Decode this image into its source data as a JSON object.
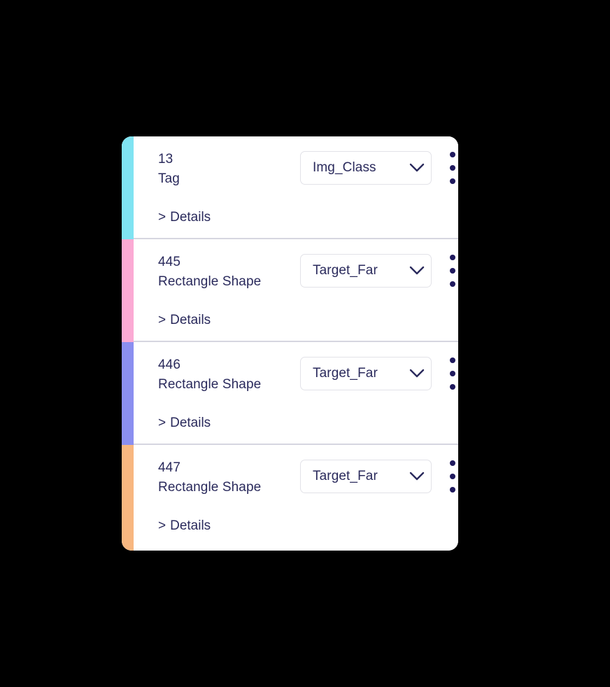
{
  "panel": {
    "name": "annotation-object-list",
    "background": "#000000",
    "card_background": "#ffffff",
    "divider_color": "#d6d6e0",
    "text_color": "#2a2a5c",
    "dot_color": "#201a5e",
    "select_border_color": "#e2e2e8"
  },
  "rows": [
    {
      "id": "13",
      "type": "Tag",
      "class_value": "Img_Class",
      "details_label": "Details",
      "details_chevron": ">",
      "strip_color": "#7fe3f2",
      "caret_icon": "chevron-down-icon",
      "menu_icon": "kebab-menu-icon"
    },
    {
      "id": "445",
      "type": "Rectangle Shape",
      "class_value": "Target_Far",
      "details_label": "Details",
      "details_chevron": ">",
      "strip_color": "#fbaad4",
      "caret_icon": "chevron-down-icon",
      "menu_icon": "kebab-menu-icon"
    },
    {
      "id": "446",
      "type": "Rectangle Shape",
      "class_value": "Target_Far",
      "details_label": "Details",
      "details_chevron": ">",
      "strip_color": "#8b8ff0",
      "caret_icon": "chevron-down-icon",
      "menu_icon": "kebab-menu-icon"
    },
    {
      "id": "447",
      "type": "Rectangle Shape",
      "class_value": "Target_Far",
      "details_label": "Details",
      "details_chevron": ">",
      "strip_color": "#f8b780",
      "caret_icon": "chevron-down-icon",
      "menu_icon": "kebab-menu-icon"
    }
  ]
}
